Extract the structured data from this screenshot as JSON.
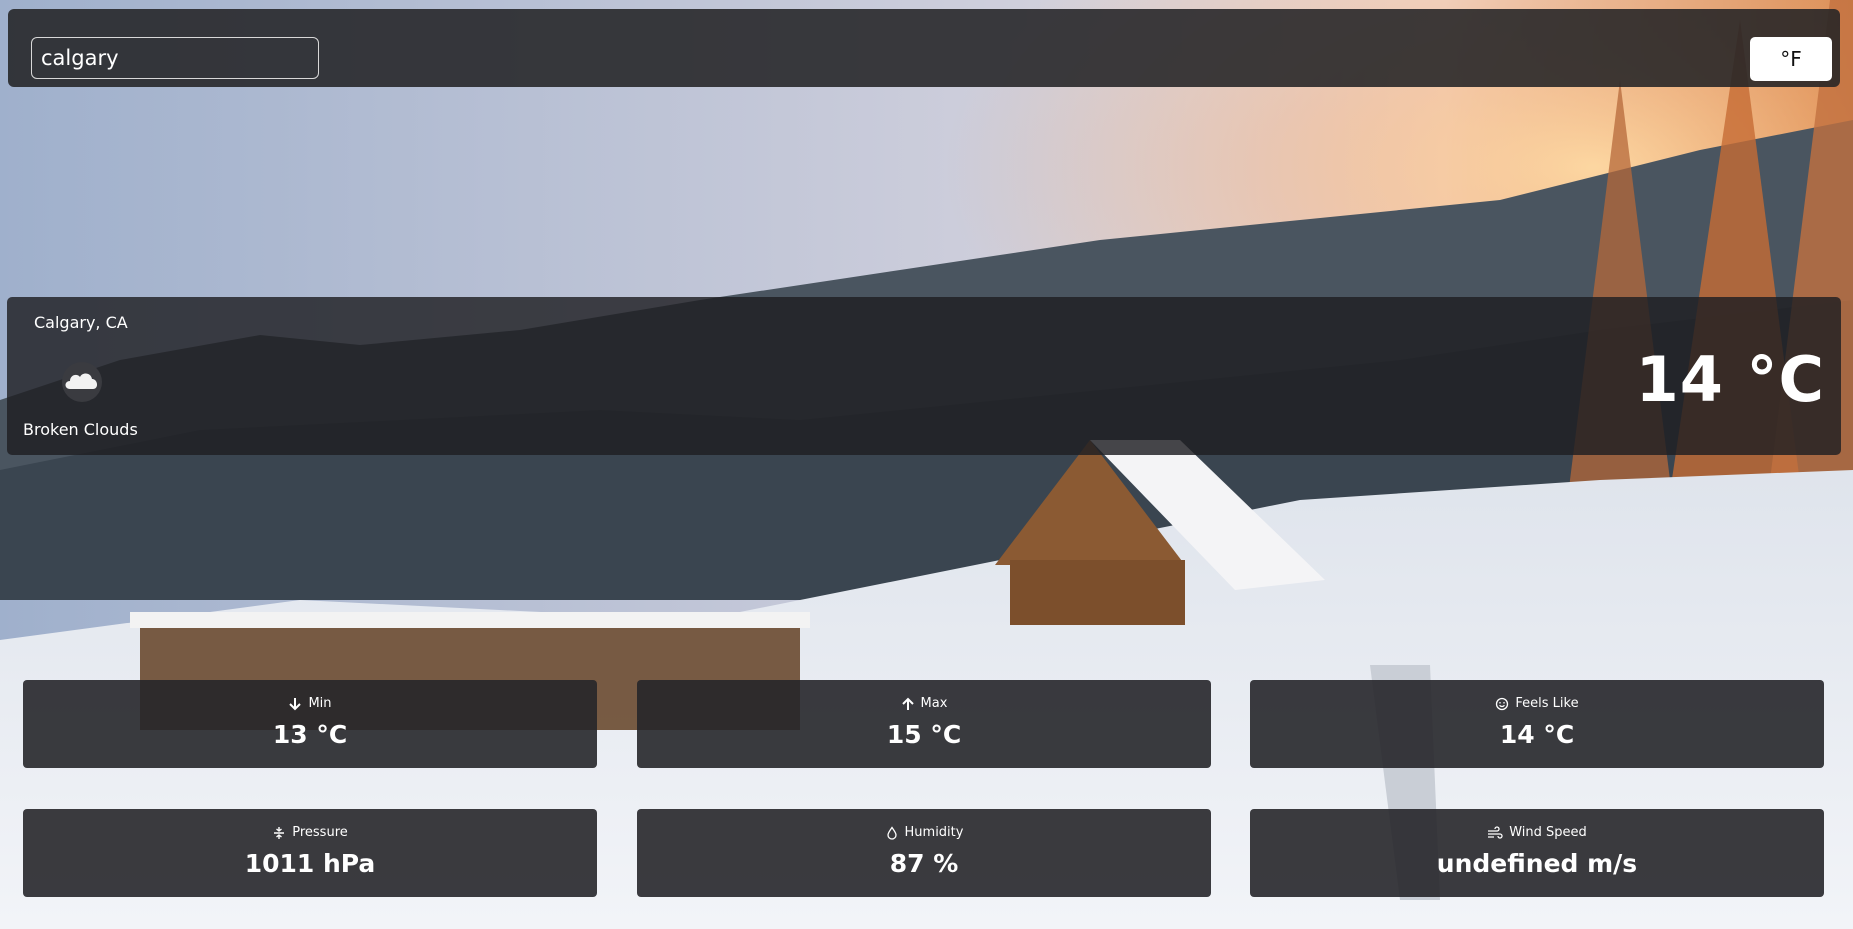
{
  "search": {
    "value": "calgary"
  },
  "unit_toggle": {
    "label": "°F"
  },
  "current": {
    "location": "Calgary, CA",
    "condition": "Broken Clouds",
    "condition_icon": "cloud-icon",
    "temperature": "14 °C"
  },
  "stats": [
    {
      "label": "Min",
      "value": "13 °C",
      "icon": "arrow-down-icon"
    },
    {
      "label": "Max",
      "value": "15 °C",
      "icon": "arrow-up-icon"
    },
    {
      "label": "Feels Like",
      "value": "14 °C",
      "icon": "smiley-icon"
    },
    {
      "label": "Pressure",
      "value": "1011 hPa",
      "icon": "pressure-icon"
    },
    {
      "label": "Humidity",
      "value": "87 %",
      "icon": "droplet-icon"
    },
    {
      "label": "Wind Speed",
      "value": "undefined m/s",
      "icon": "wind-icon"
    }
  ],
  "colors": {
    "panel": "#232326",
    "button_bg": "#ffffff",
    "text": "#ffffff"
  }
}
